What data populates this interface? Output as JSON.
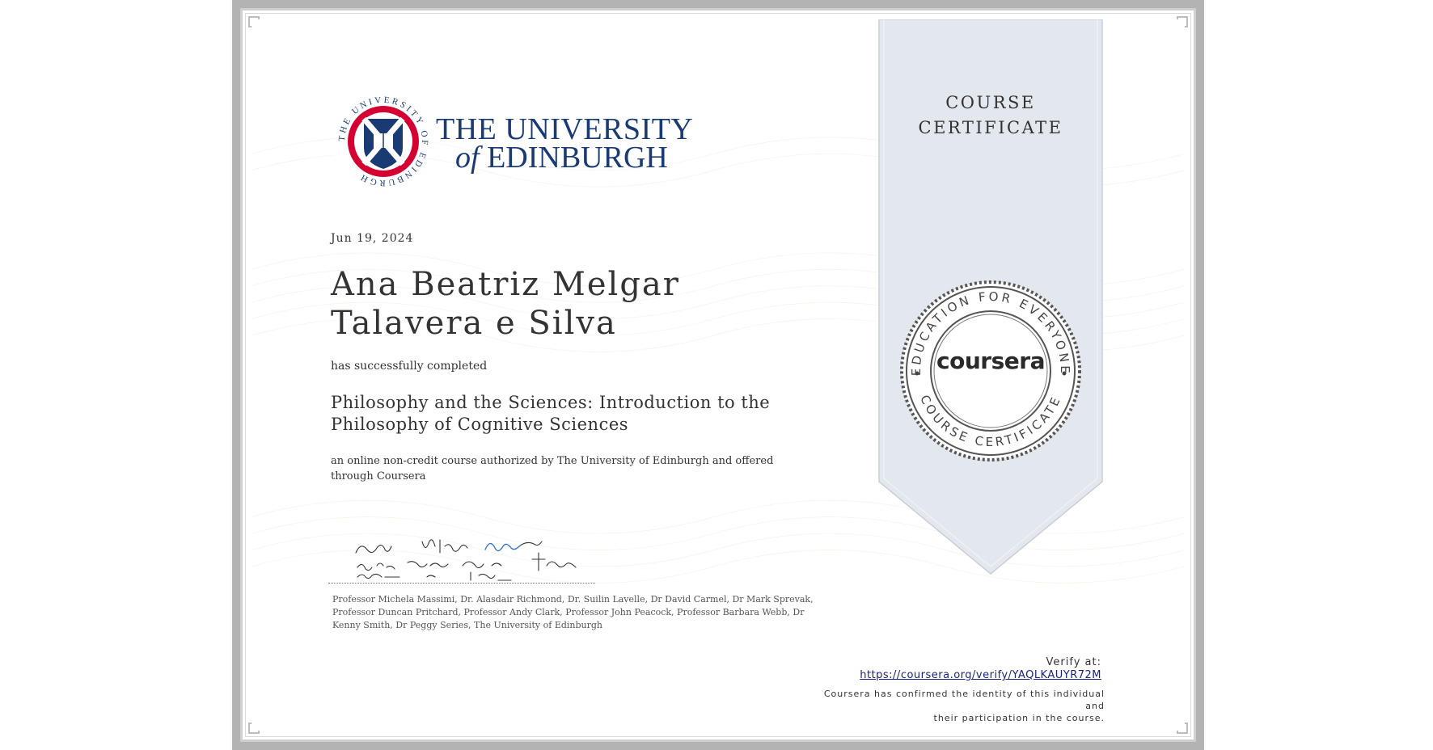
{
  "certificate": {
    "date": "Jun 19, 2024",
    "recipient": "Ana Beatriz Melgar Talavera e Silva",
    "completed_text": "has successfully completed",
    "course_title": "Philosophy and the Sciences: Introduction to the Philosophy of Cognitive Sciences",
    "authorization": "an online non-credit course authorized by The University of Edinburgh and offered through Coursera",
    "instructors": "Professor Michela Massimi, Dr. Alasdair Richmond, Dr. Suilin Lavelle, Dr David Carmel, Dr Mark Sprevak, Professor Duncan Pritchard, Professor Andy Clark, Professor John Peacock, Professor Barbara Webb, Dr Kenny Smith, Dr Peggy Series, The University of Edinburgh"
  },
  "logo": {
    "line1": "THE UNIVERSITY",
    "line2_of": "of",
    "line2_name": "EDINBURGH",
    "seal_text": "THE UNIVERSITY OF EDINBURGH"
  },
  "ribbon": {
    "line1": "COURSE",
    "line2": "CERTIFICATE"
  },
  "seal": {
    "brand": "coursera",
    "ring_top": "EDUCATION FOR EVERYONE",
    "ring_bottom": "COURSE CERTIFICATE"
  },
  "verify": {
    "label": "Verify at:",
    "url": "https://coursera.org/verify/YAQLKAUYR72M",
    "confirm_line1": "Coursera has confirmed the identity of this individual and",
    "confirm_line2": "their participation in the course."
  },
  "colors": {
    "frame": "#b3b3b3",
    "ribbon": "#e3e8ef",
    "edinburgh_blue": "#1a3a73",
    "edinburgh_red": "#d50032",
    "link": "#1a237e"
  }
}
